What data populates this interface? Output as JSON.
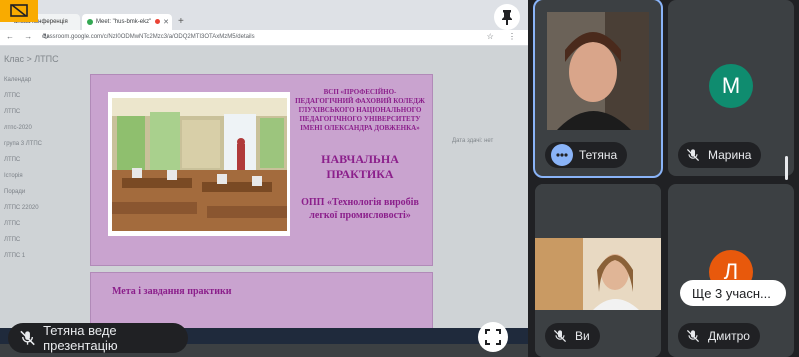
{
  "browser": {
    "tabs": [
      {
        "label": "анова конференція"
      },
      {
        "label": "Meet: \"hus-bmk-ekz\""
      },
      {
        "label": "+"
      }
    ],
    "url": "classroom.google.com/c/NzI0ODMwNTc2Mzc3/a/ODQ2MTI3OTAxMzM5/details",
    "class_title": "Клас > ЛТПС",
    "due_text": "Дата здачі: нет",
    "sidebar_items": [
      "Календар",
      "ЛТПС",
      "ЛТПС",
      "лтпс-2020",
      "група 3 ЛТПС",
      "ЛТПС",
      "Історія",
      "Поради",
      "ЛТПС 22020",
      "ЛТПС",
      "ЛТПС",
      "ЛТПС 1"
    ]
  },
  "slide": {
    "org": "ВСП «ПРОФЕСІЙНО-ПЕДАГОГІЧНИЙ ФАХОВИЙ КОЛЕДЖ ГЛУХІВСЬКОГО НАЦІОНАЛЬНОГО ПЕДАГОГІЧНОГО УНІВЕРСИТЕТУ ІМЕНІ ОЛЕКСАНДРА ДОВЖЕНКА»",
    "title": "НАВЧАЛЬНА ПРАКТИКА",
    "program": "ОПП «Технологія виробів легкої промисловості»",
    "next_title": "Мета і завдання практики"
  },
  "meet": {
    "presenting_label": "Тетяна веде презентацію",
    "participants": [
      {
        "name": "Тетяна",
        "speaking": true
      },
      {
        "name": "Марина",
        "initial": "М",
        "muted": true
      },
      {
        "name": "Ви",
        "muted": true
      },
      {
        "name": "Дмитро",
        "initial": "Л",
        "muted": true
      }
    ],
    "more_label": "Ще 3 учасн..."
  },
  "colors": {
    "accent": "#8ab4f8",
    "avatar_m": "#0f8c6f",
    "avatar_l": "#e8590c",
    "slide_bg": "#c9a3cf",
    "slide_text": "#8b1f8b"
  }
}
